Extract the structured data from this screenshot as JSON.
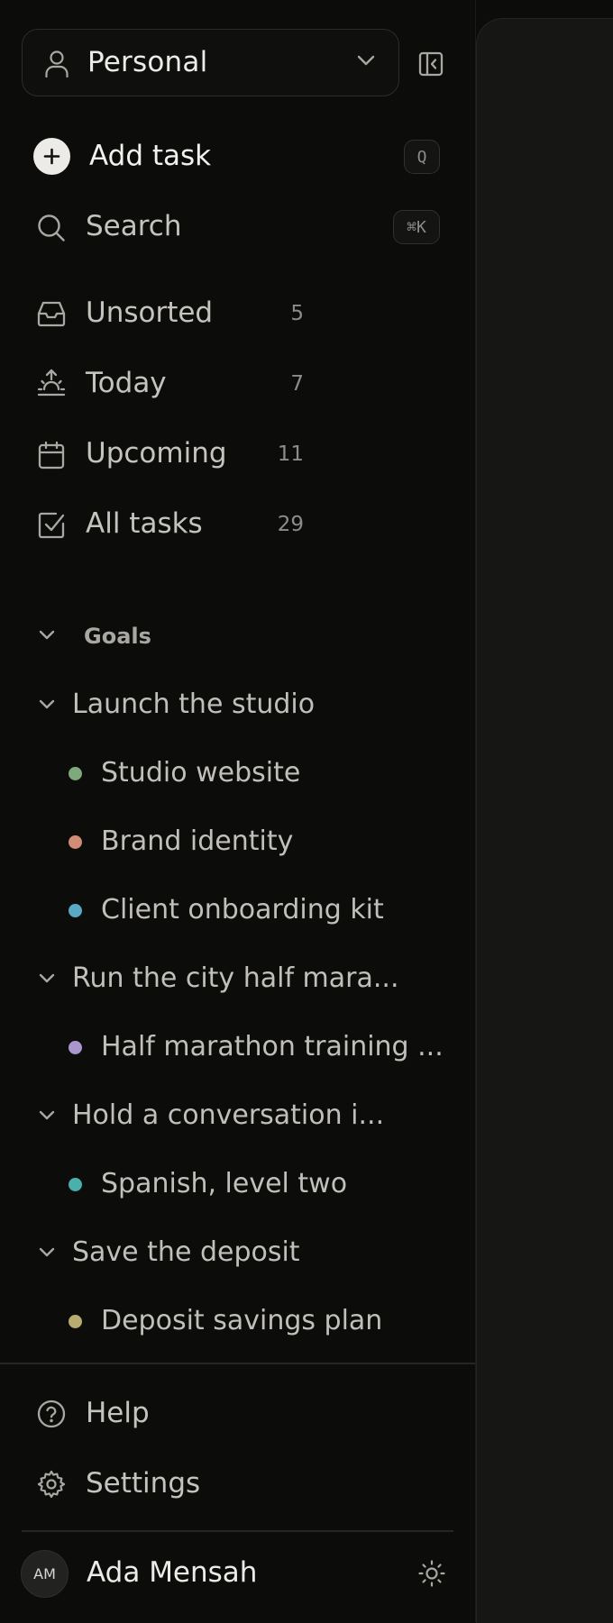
{
  "workspace": {
    "name": "Personal"
  },
  "actions": {
    "add_task": {
      "label": "Add task",
      "shortcut": "Q"
    },
    "search": {
      "label": "Search",
      "shortcut": "⌘K"
    }
  },
  "nav": [
    {
      "label": "Unsorted",
      "count": "5",
      "icon": "inbox-icon"
    },
    {
      "label": "Today",
      "count": "7",
      "icon": "sunrise-icon"
    },
    {
      "label": "Upcoming",
      "count": "11",
      "icon": "calendar-icon"
    },
    {
      "label": "All tasks",
      "count": "29",
      "icon": "check-square-icon"
    }
  ],
  "goals": {
    "title": "Goals",
    "items": [
      {
        "label": "Launch the studio",
        "projects": [
          {
            "label": "Studio website",
            "color": "#7fa97c"
          },
          {
            "label": "Brand identity",
            "color": "#d18c76"
          },
          {
            "label": "Client onboarding kit",
            "color": "#5aa9c4"
          }
        ]
      },
      {
        "label": "Run the city half mara...",
        "projects": [
          {
            "label": "Half marathon training ...",
            "color": "#a996cf"
          }
        ]
      },
      {
        "label": "Hold a conversation i...",
        "projects": [
          {
            "label": "Spanish, level two",
            "color": "#49b0ad"
          }
        ]
      },
      {
        "label": "Save the deposit",
        "projects": [
          {
            "label": "Deposit savings plan",
            "color": "#b8ad6e"
          }
        ]
      }
    ]
  },
  "footer": {
    "help": "Help",
    "settings": "Settings",
    "user": {
      "initials": "AM",
      "name": "Ada Mensah"
    }
  }
}
